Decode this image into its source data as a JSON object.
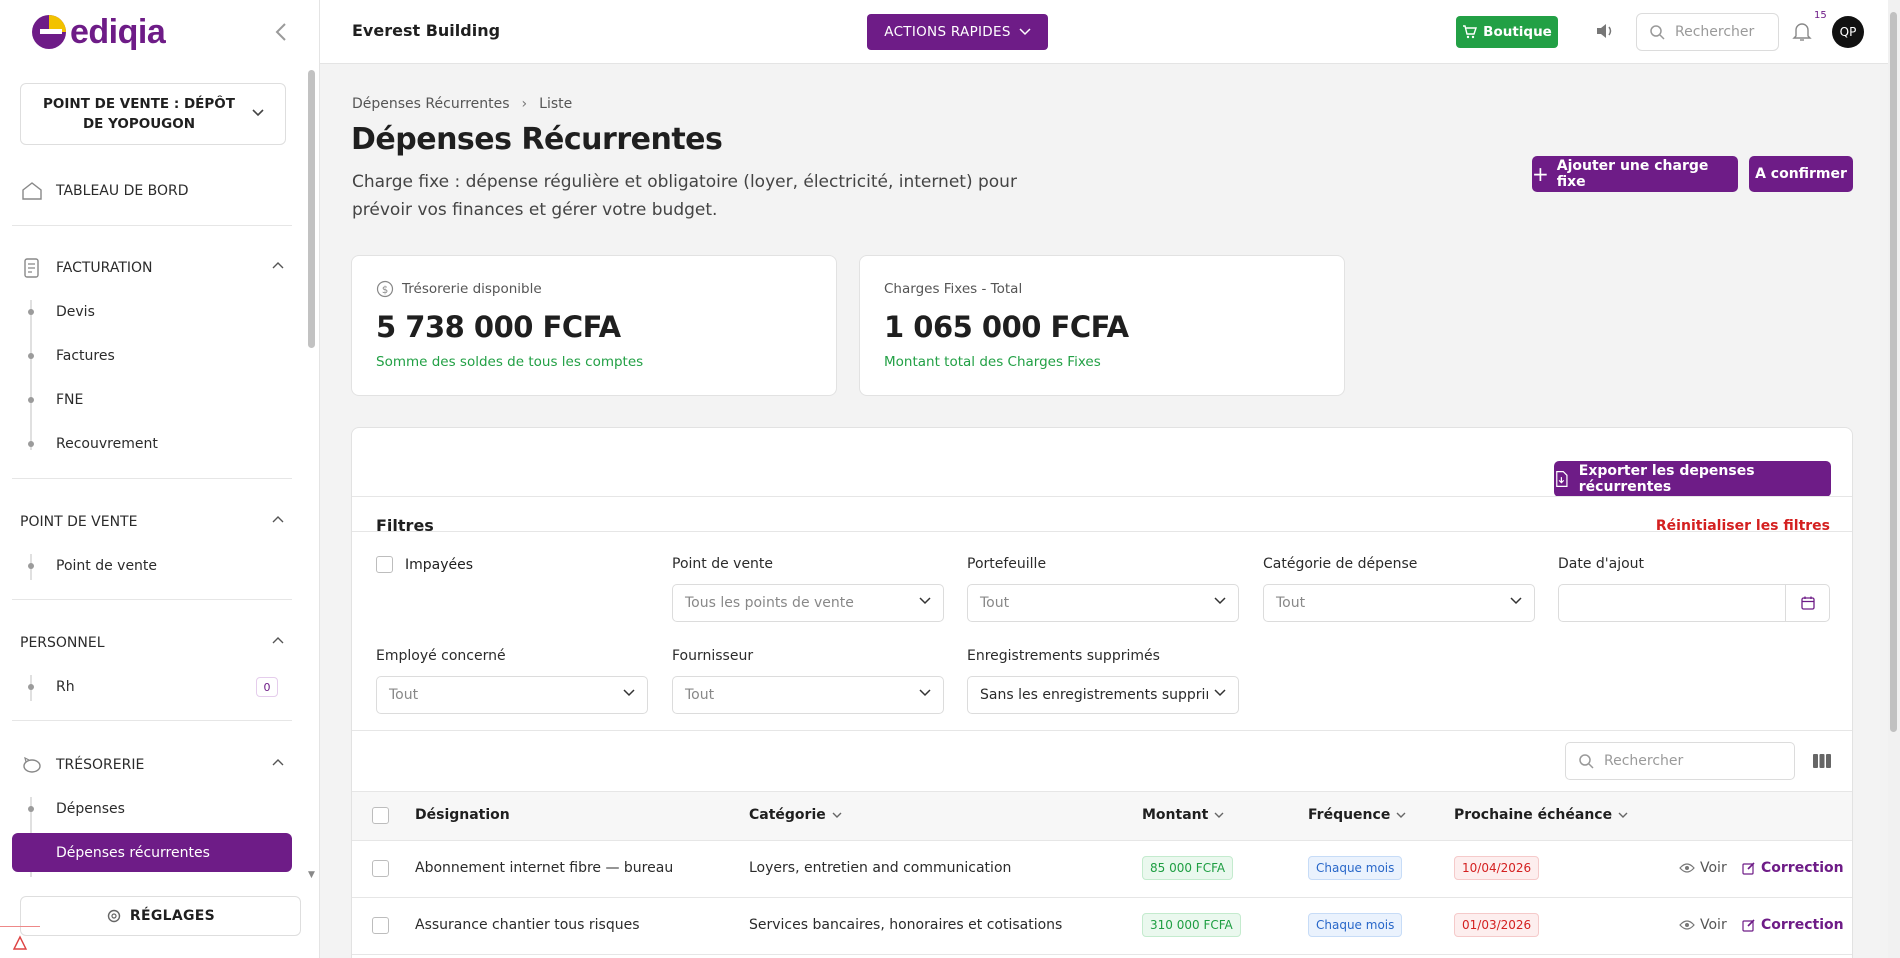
{
  "brand": {
    "name": "ediqia",
    "accent": "#6e1c87",
    "success": "#22a045",
    "danger": "#d42020"
  },
  "sidebar": {
    "point_of_sale_selector": "POINT DE VENTE : DÉPÔT DE YOPOUGON",
    "dashboard": "TABLEAU DE BORD",
    "facturation": {
      "label": "FACTURATION",
      "items": [
        "Devis",
        "Factures",
        "FNE",
        "Recouvrement"
      ]
    },
    "point_de_vente": {
      "label": "POINT DE VENTE",
      "items": [
        "Point de vente"
      ]
    },
    "personnel": {
      "label": "PERSONNEL",
      "items": [
        "Rh"
      ],
      "rh_badge": "0"
    },
    "tresorerie": {
      "label": "TRÉSORERIE",
      "items": [
        "Dépenses",
        "Dépenses récurrentes"
      ]
    },
    "settings": "RÉGLAGES"
  },
  "topbar": {
    "company": "Everest Building",
    "quick_actions": "ACTIONS RAPIDES",
    "boutique": "Boutique",
    "search_placeholder": "Rechercher",
    "notifications_count": "15",
    "avatar_initials": "QP"
  },
  "page": {
    "breadcrumb": [
      "Dépenses Récurrentes",
      "Liste"
    ],
    "title": "Dépenses Récurrentes",
    "description": "Charge fixe : dépense régulière et obligatoire (loyer, électricité, internet) pour prévoir vos finances et gérer votre budget.",
    "add_button": "Ajouter une charge fixe",
    "confirm_button": "A confirmer"
  },
  "stats": [
    {
      "label": "Trésorerie disponible",
      "value": "5 738 000 FCFA",
      "subtitle": "Somme des soldes de tous les comptes"
    },
    {
      "label": "Charges Fixes - Total",
      "value": "1 065 000 FCFA",
      "subtitle": "Montant total des Charges Fixes"
    }
  ],
  "panel": {
    "export_button": "Exporter les depenses récurrentes",
    "filters_title": "Filtres",
    "reset_filters": "Réinitialiser les filtres",
    "filters": {
      "unpaid": "Impayées",
      "point_of_sale": {
        "label": "Point de vente",
        "value": "Tous les points de vente"
      },
      "portfolio": {
        "label": "Portefeuille",
        "value": "Tout"
      },
      "category": {
        "label": "Catégorie de dépense",
        "value": "Tout"
      },
      "date_added": {
        "label": "Date d'ajout",
        "value": ""
      },
      "employee": {
        "label": "Employé concerné",
        "value": "Tout"
      },
      "supplier": {
        "label": "Fournisseur",
        "value": "Tout"
      },
      "deleted": {
        "label": "Enregistrements supprimés",
        "value": "Sans les enregistrements supprimés"
      }
    },
    "table_search_placeholder": "Rechercher",
    "columns": [
      "Désignation",
      "Catégorie",
      "Montant",
      "Fréquence",
      "Prochaine échéance"
    ],
    "rows": [
      {
        "designation": "Abonnement internet fibre — bureau",
        "category": "Loyers, entretien and communication",
        "amount": "85 000 FCFA",
        "frequency": "Chaque mois",
        "next_due": "10/04/2026"
      },
      {
        "designation": "Assurance chantier tous risques",
        "category": "Services bancaires, honoraires et cotisations",
        "amount": "310 000 FCFA",
        "frequency": "Chaque mois",
        "next_due": "01/03/2026"
      }
    ],
    "view_label": "Voir",
    "edit_label": "Correction"
  }
}
